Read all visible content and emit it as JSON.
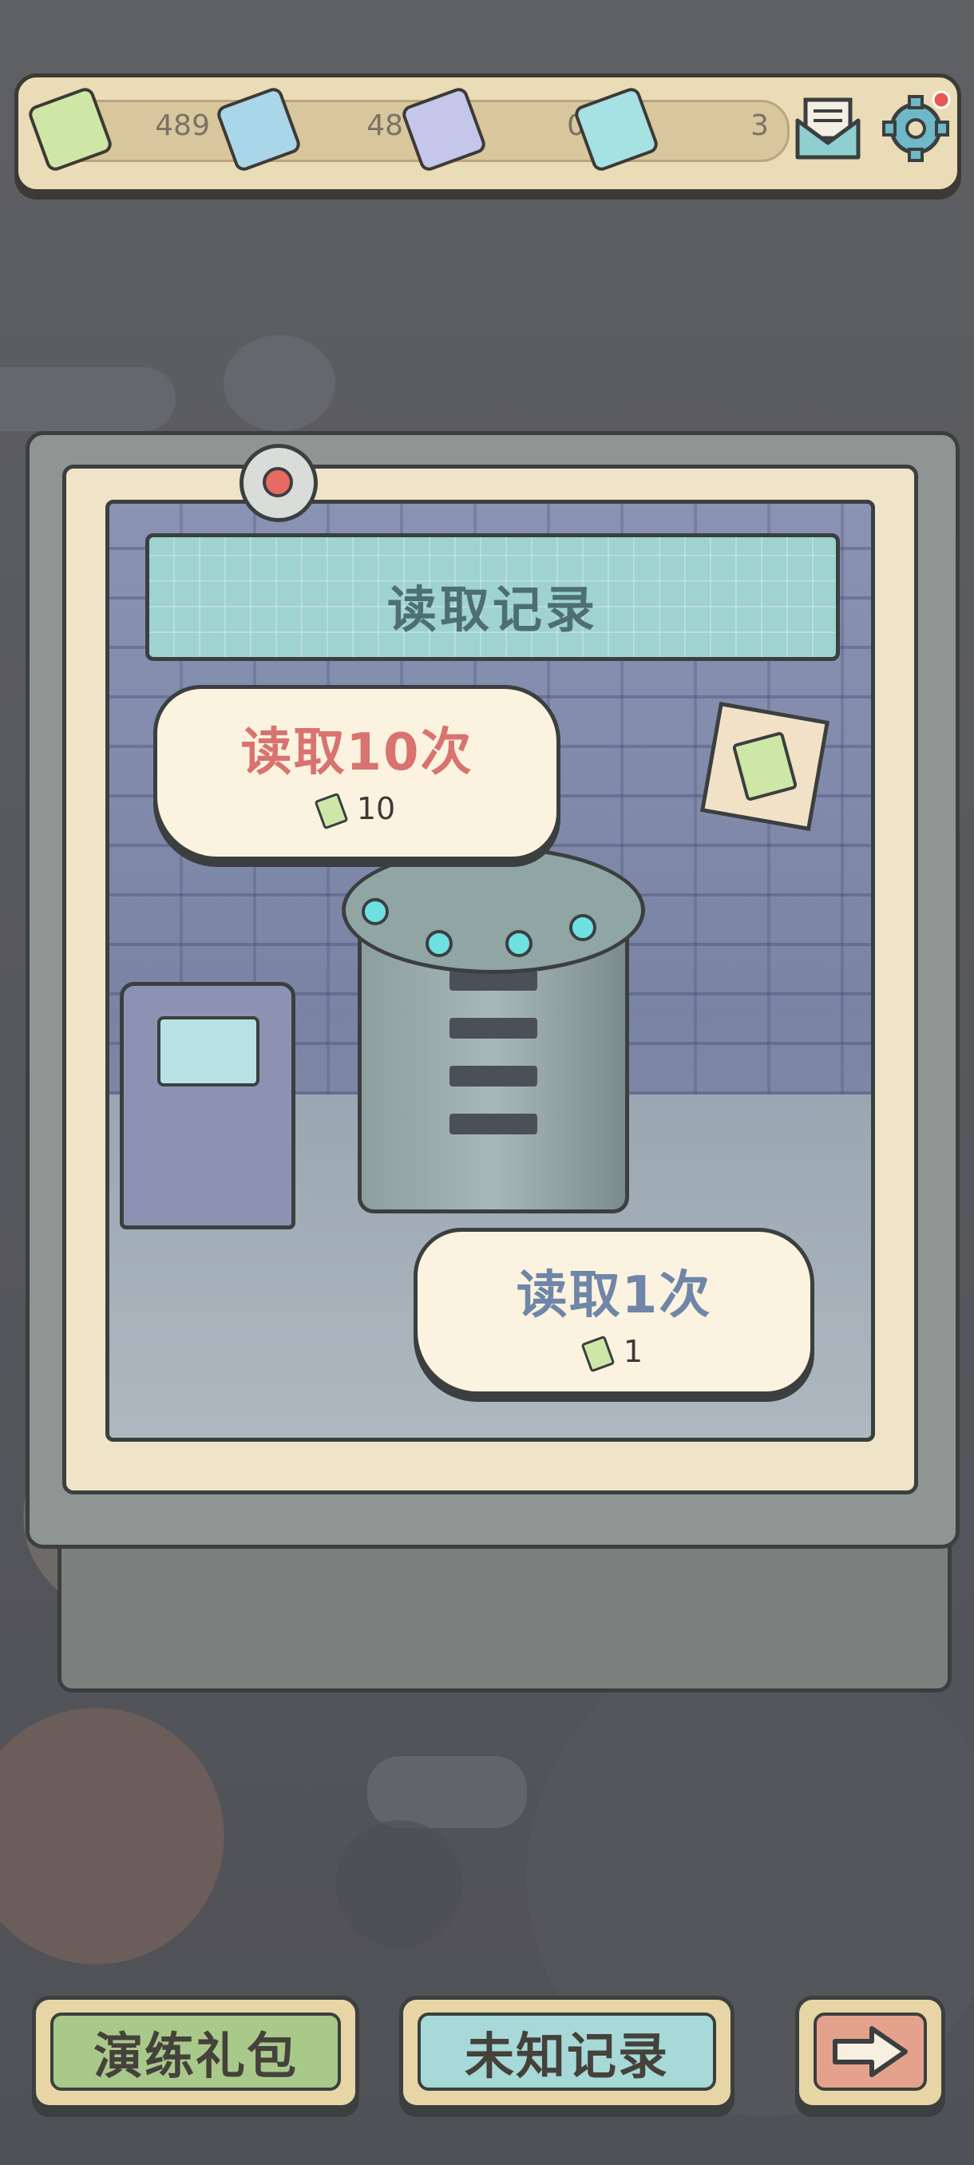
{
  "currency": [
    {
      "icon": "ticket-green-icon",
      "value": "489"
    },
    {
      "icon": "ticket-blue-icon",
      "value": "48"
    },
    {
      "icon": "ticket-lilac-icon",
      "value": "0"
    },
    {
      "icon": "ticket-cyan-icon",
      "value": "3"
    }
  ],
  "header": {
    "mail_icon": "mail-icon",
    "settings_icon": "gear-icon"
  },
  "panel": {
    "title": "读取记录",
    "read_ten": {
      "label": "读取10次",
      "cost": "10"
    },
    "read_one": {
      "label": "读取1次",
      "cost": "1"
    }
  },
  "buttons": {
    "gift": "演练礼包",
    "unknown": "未知记录",
    "next_icon": "arrow-right-icon"
  },
  "colors": {
    "read_ten": "#d97370",
    "read_one": "#6f86a8",
    "title": "#4d6f73"
  }
}
